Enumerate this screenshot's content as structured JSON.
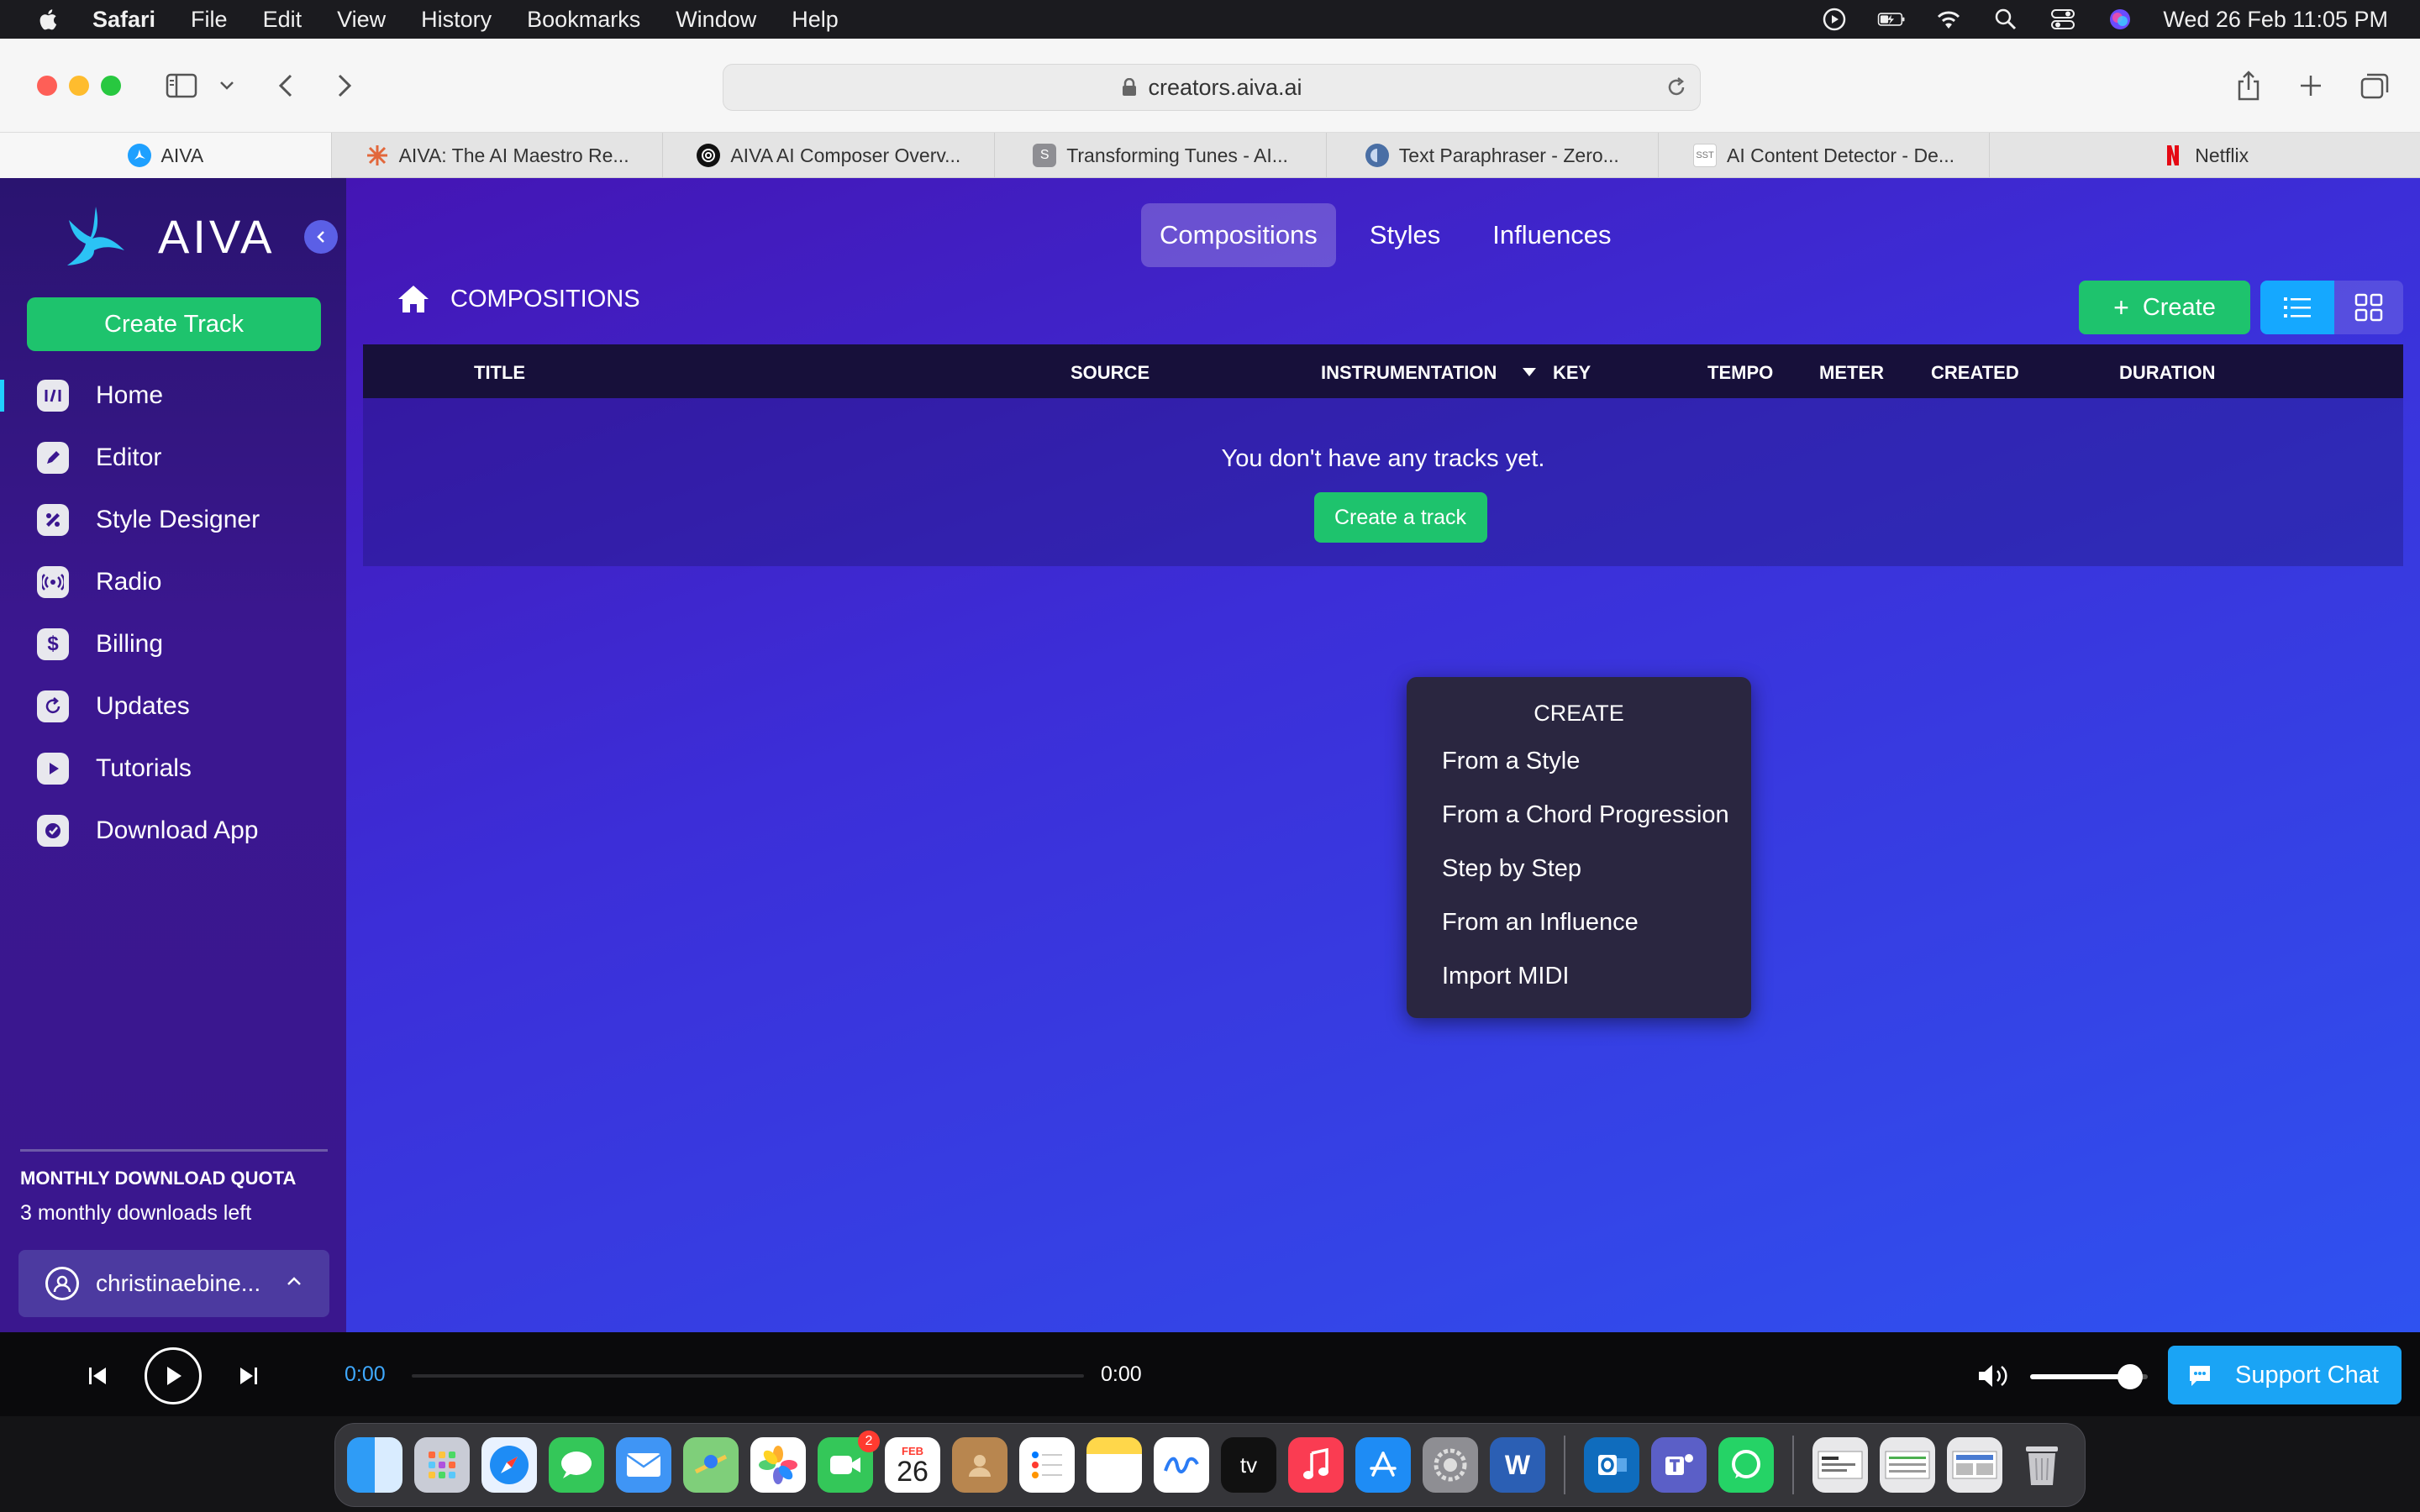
{
  "menubar": {
    "app_name": "Safari",
    "items": [
      "File",
      "Edit",
      "View",
      "History",
      "Bookmarks",
      "Window",
      "Help"
    ],
    "datetime": "Wed 26 Feb  11:05 PM"
  },
  "browser": {
    "url": "creators.aiva.ai",
    "tabs": [
      {
        "label": "AIVA",
        "icon": "aiva-icon",
        "color": "#1ea0ff"
      },
      {
        "label": "AIVA: The AI Maestro Re...",
        "icon": "spark-icon",
        "color": "#e2673b"
      },
      {
        "label": "AIVA AI Composer Overv...",
        "icon": "openai-icon",
        "color": "#111111"
      },
      {
        "label": "Transforming Tunes - AI...",
        "icon": "s-icon",
        "color": "#8e8e93"
      },
      {
        "label": "Text Paraphraser - Zero...",
        "icon": "brain-icon",
        "color": "#4a6fa5"
      },
      {
        "label": "AI Content Detector - De...",
        "icon": "sst-icon",
        "color": "#ffffff"
      },
      {
        "label": "Netflix",
        "icon": "netflix-icon",
        "color": "#e50914"
      }
    ]
  },
  "sidebar": {
    "brand": "AIVA",
    "create_track": "Create Track",
    "nav": [
      {
        "label": "Home",
        "icon": "home-icon"
      },
      {
        "label": "Editor",
        "icon": "pencil-icon"
      },
      {
        "label": "Style Designer",
        "icon": "style-icon"
      },
      {
        "label": "Radio",
        "icon": "radio-icon"
      },
      {
        "label": "Billing",
        "icon": "dollar-icon"
      },
      {
        "label": "Updates",
        "icon": "refresh-icon"
      },
      {
        "label": "Tutorials",
        "icon": "play-icon"
      },
      {
        "label": "Download App",
        "icon": "download-icon"
      }
    ],
    "quota_title": "MONTHLY DOWNLOAD QUOTA",
    "quota_left": "3 monthly downloads left",
    "account": "christinaebine..."
  },
  "main": {
    "tabs": [
      "Compositions",
      "Styles",
      "Influences"
    ],
    "breadcrumb": "COMPOSITIONS",
    "create_button": "Create",
    "columns": [
      "TITLE",
      "SOURCE",
      "INSTRUMENTATION",
      "KEY",
      "TEMPO",
      "METER",
      "CREATED",
      "DURATION"
    ],
    "empty_text": "You don't have any tracks yet.",
    "create_a_track": "Create a track"
  },
  "dropdown": {
    "title": "CREATE",
    "items": [
      "From a Style",
      "From a Chord Progression",
      "Step by Step",
      "From an Influence",
      "Import MIDI"
    ]
  },
  "player": {
    "time_current": "0:00",
    "time_total": "0:00",
    "volume": 0.85,
    "support_chat": "Support Chat"
  },
  "dock": {
    "calendar_month": "FEB",
    "calendar_day": "26",
    "facetime_badge": "2",
    "appletv_label": "tv",
    "word_label": "W"
  },
  "colors": {
    "accent_green": "#1ec36d",
    "accent_blue": "#1aa4f5",
    "main_gradient_start": "#4415b4",
    "main_gradient_end": "#2f52f0"
  }
}
